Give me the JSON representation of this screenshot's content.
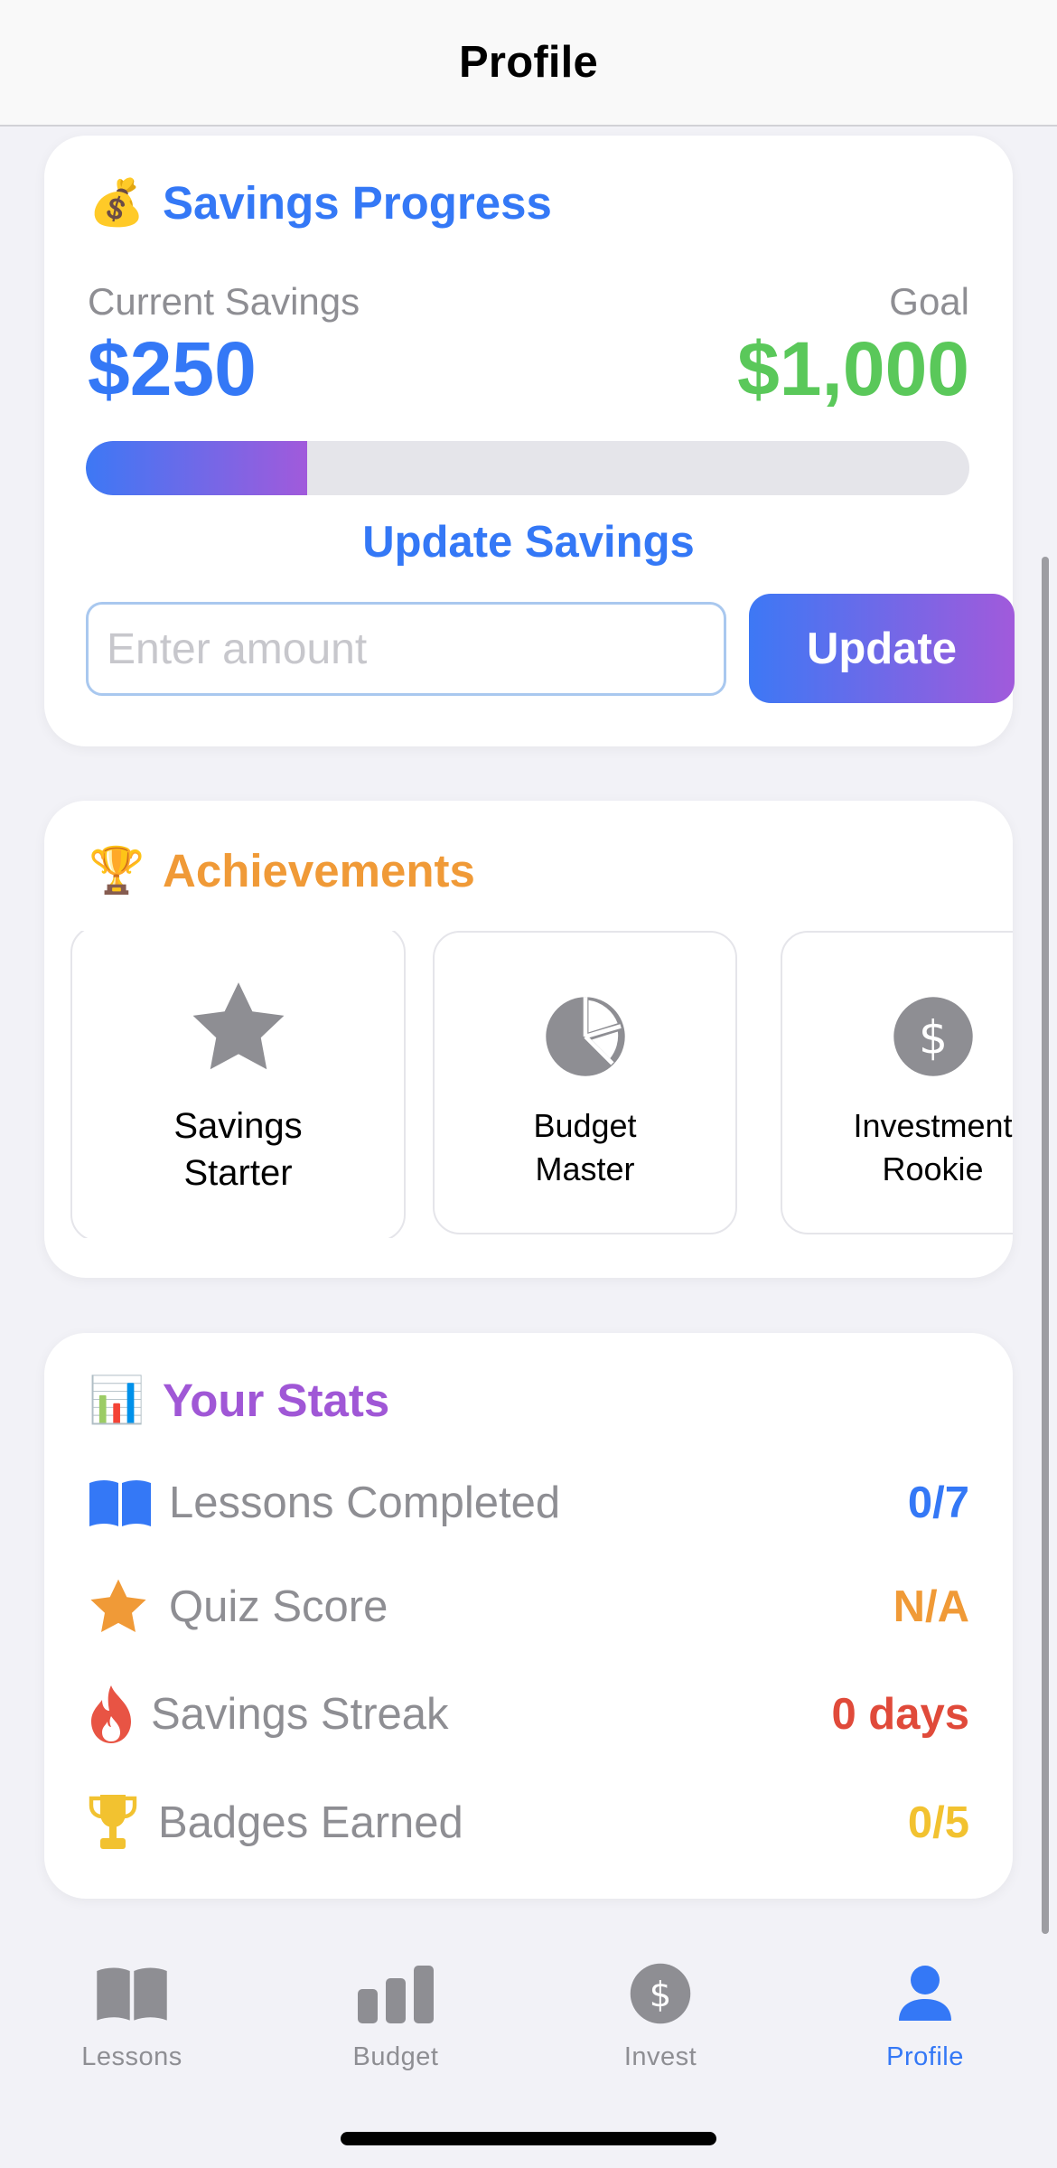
{
  "nav": {
    "title": "Profile"
  },
  "savings": {
    "emoji": "💰",
    "title": "Savings Progress",
    "current_label": "Current Savings",
    "current_value": "$250",
    "goal_label": "Goal",
    "goal_value": "$1,000",
    "progress_fraction": 0.25,
    "update_title": "Update Savings",
    "input_placeholder": "Enter amount",
    "input_value": "",
    "button_label": "Update",
    "colors": {
      "current": "#3478f6",
      "goal": "#5ac85a",
      "gradient_start": "#3d78f5",
      "gradient_end": "#a15adb"
    }
  },
  "achievements": {
    "emoji": "🏆",
    "title": "Achievements",
    "title_color": "#f09a37",
    "items": [
      {
        "icon": "star-icon",
        "label": "Savings\nStarter"
      },
      {
        "icon": "pie-chart-icon",
        "label": "Budget\nMaster"
      },
      {
        "icon": "dollar-circle-icon",
        "label": "Investment\nRookie"
      }
    ]
  },
  "stats": {
    "emoji": "📊",
    "title": "Your Stats",
    "title_color": "#a057d6",
    "rows": [
      {
        "icon": "book-icon",
        "label": "Lessons Completed",
        "value": "0/7",
        "color": "#3478f6"
      },
      {
        "icon": "star-icon",
        "label": "Quiz Score",
        "value": "N/A",
        "color": "#f09a37"
      },
      {
        "icon": "flame-icon",
        "label": "Savings Streak",
        "value": "0 days",
        "color": "#e04a3a"
      },
      {
        "icon": "trophy-icon",
        "label": "Badges Earned",
        "value": "0/5",
        "color": "#f2c230"
      }
    ]
  },
  "tabbar": {
    "active": "Profile",
    "tabs": [
      {
        "icon": "book-icon",
        "label": "Lessons"
      },
      {
        "icon": "bar-chart-icon",
        "label": "Budget"
      },
      {
        "icon": "dollar-circle-icon",
        "label": "Invest"
      },
      {
        "icon": "person-icon",
        "label": "Profile"
      }
    ]
  }
}
